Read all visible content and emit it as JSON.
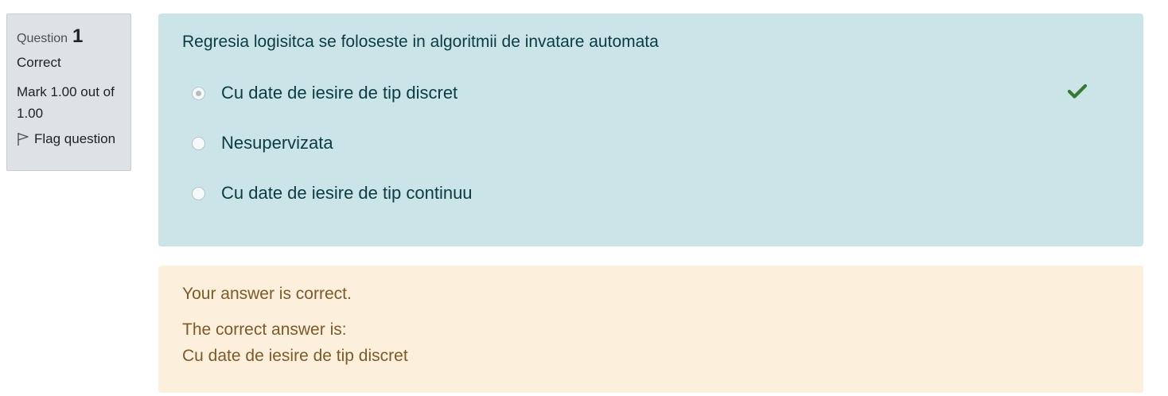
{
  "info": {
    "question_label": "Question",
    "question_number": "1",
    "state": "Correct",
    "grade": "Mark 1.00 out of 1.00",
    "flag_label": "Flag question",
    "flag_icon": "flag-icon"
  },
  "formulation": {
    "question_text": "Regresia logisitca se foloseste in algoritmii de invatare automata",
    "answers": [
      {
        "label": "Cu date de iesire de tip discret",
        "selected": true,
        "correct": true
      },
      {
        "label": "Nesupervizata",
        "selected": false,
        "correct": false
      },
      {
        "label": "Cu date de iesire de tip continuu",
        "selected": false,
        "correct": false
      }
    ],
    "correct_icon": "check-icon"
  },
  "feedback": {
    "specific": "Your answer is correct.",
    "right_answer_label": "The correct answer is:",
    "right_answer_value": "Cu date de iesire de tip discret"
  },
  "colors": {
    "formulation_bg": "#cbe4e8",
    "feedback_bg": "#fcefdc",
    "info_bg": "#dee2e6",
    "check_green": "#357a32"
  }
}
